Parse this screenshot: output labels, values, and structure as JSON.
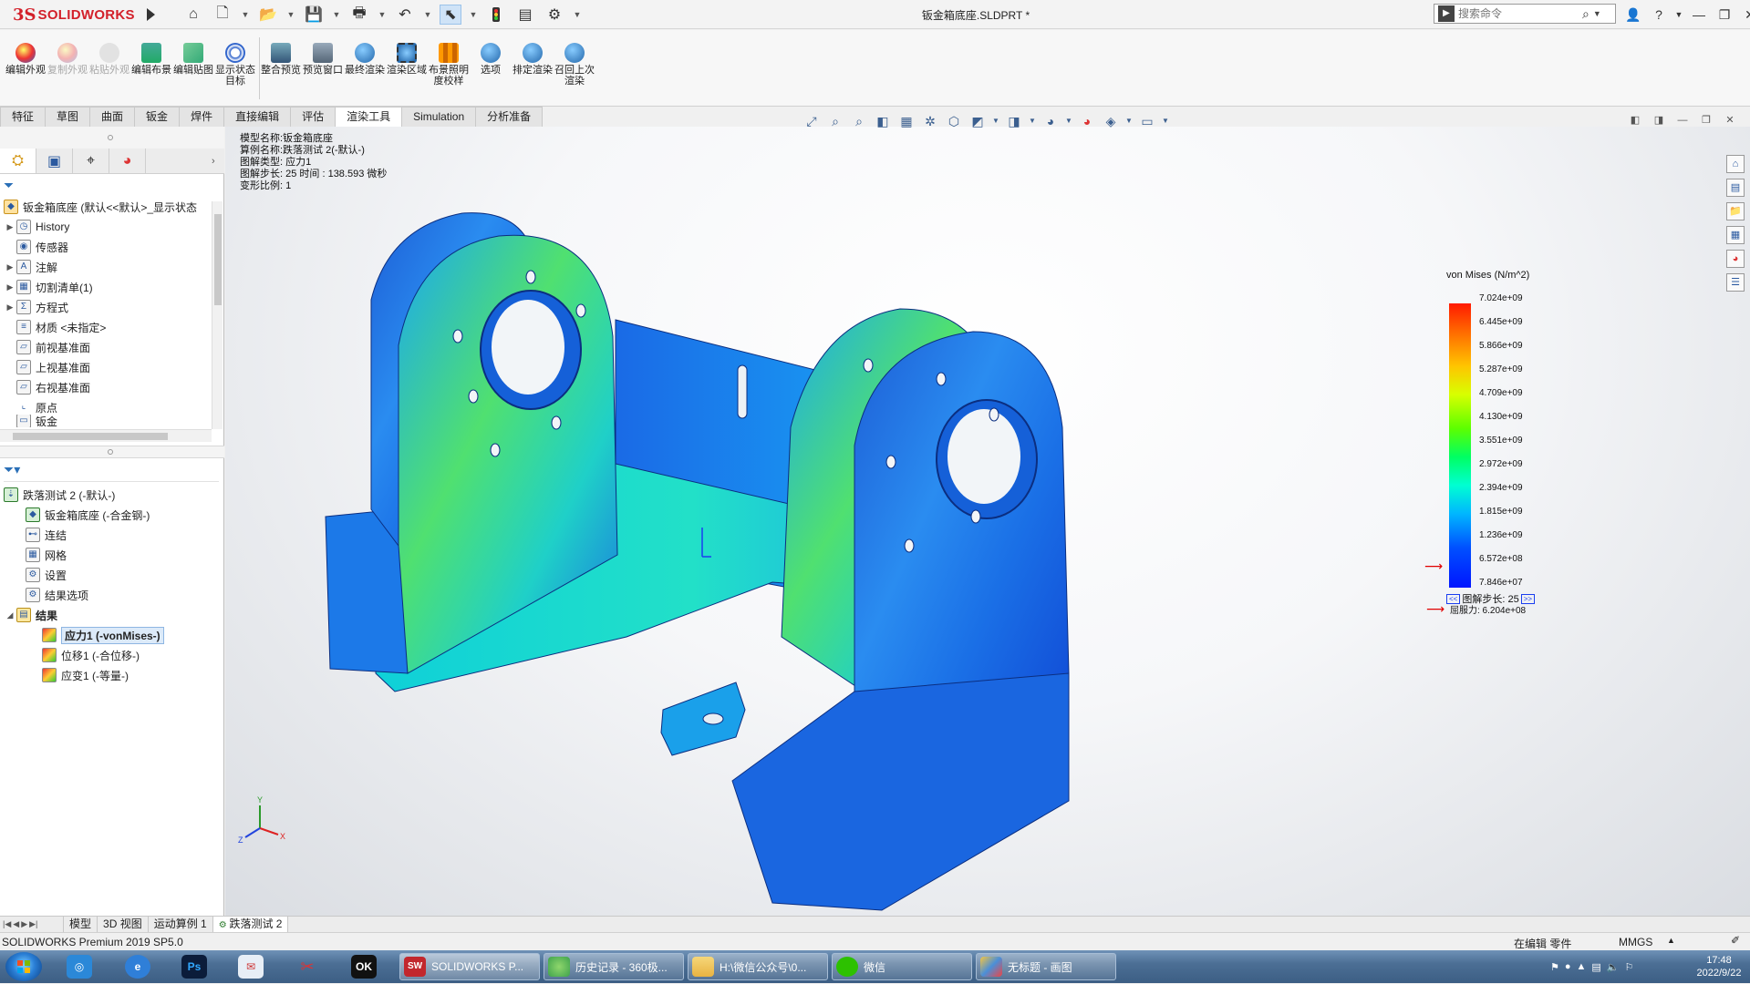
{
  "app": {
    "logo_text": "SOLIDWORKS",
    "window_title": "钣金箱底座.SLDPRT *",
    "search_placeholder": "搜索命令"
  },
  "commands": [
    {
      "label": "编辑外观",
      "enabled": true
    },
    {
      "label": "复制外观",
      "enabled": false
    },
    {
      "label": "粘贴外观",
      "enabled": false
    },
    {
      "label": "编辑布景",
      "enabled": true
    },
    {
      "label": "编辑贴图",
      "enabled": true
    },
    {
      "label": "显示状态目标",
      "enabled": true
    },
    {
      "label": "整合预览",
      "enabled": true
    },
    {
      "label": "预览窗口",
      "enabled": true
    },
    {
      "label": "最终渲染",
      "enabled": true
    },
    {
      "label": "渲染区域",
      "enabled": true
    },
    {
      "label": "布景照明度校样",
      "enabled": true
    },
    {
      "label": "选项",
      "enabled": true
    },
    {
      "label": "排定渲染",
      "enabled": true
    },
    {
      "label": "召回上次渲染",
      "enabled": true
    }
  ],
  "tabs": [
    "特征",
    "草图",
    "曲面",
    "钣金",
    "焊件",
    "直接编辑",
    "评估",
    "渲染工具",
    "Simulation",
    "分析准备"
  ],
  "active_tab": "渲染工具",
  "feature_tree": {
    "root": "钣金箱底座 (默认<<默认>_显示状态",
    "items": [
      {
        "label": "History",
        "expandable": true
      },
      {
        "label": "传感器",
        "expandable": false
      },
      {
        "label": "注解",
        "expandable": true
      },
      {
        "label": "切割清单(1)",
        "expandable": true
      },
      {
        "label": "方程式",
        "expandable": true
      },
      {
        "label": "材质 <未指定>",
        "expandable": false
      },
      {
        "label": "前视基准面",
        "expandable": false
      },
      {
        "label": "上视基准面",
        "expandable": false
      },
      {
        "label": "右视基准面",
        "expandable": false
      },
      {
        "label": "原点",
        "expandable": false
      },
      {
        "label": "钣金",
        "expandable": false
      }
    ]
  },
  "simulation_tree": {
    "root": "跌落测试 2 (-默认-)",
    "items": [
      {
        "label": "钣金箱底座 (-合金钢-)",
        "indent": 1
      },
      {
        "label": "连结",
        "indent": 1
      },
      {
        "label": "网格",
        "indent": 1
      },
      {
        "label": "设置",
        "indent": 1
      },
      {
        "label": "结果选项",
        "indent": 1
      },
      {
        "label": "结果",
        "indent": 0,
        "bold": true
      },
      {
        "label": "应力1 (-vonMises-)",
        "indent": 2,
        "selected": true
      },
      {
        "label": "位移1 (-合位移-)",
        "indent": 2
      },
      {
        "label": "应变1 (-等量-)",
        "indent": 2
      }
    ]
  },
  "plot_info": [
    "模型名称:钣金箱底座",
    "算例名称:跌落测试 2(-默认-)",
    "图解类型: 应力1",
    "图解步长: 25   时间 : 138.593 微秒",
    "变形比例: 1"
  ],
  "legend": {
    "title": "von Mises (N/m^2)",
    "values": [
      "7.024e+09",
      "6.445e+09",
      "5.866e+09",
      "5.287e+09",
      "4.709e+09",
      "4.130e+09",
      "3.551e+09",
      "2.972e+09",
      "2.394e+09",
      "1.815e+09",
      "1.236e+09",
      "6.572e+08",
      "7.846e+07"
    ],
    "nav_prev": "<<",
    "nav_next": ">>",
    "step_label": "图解步长: 25",
    "yield_label": "屈服力: 6.204e+08",
    "colors": {
      "max": "#ff1a00",
      "mid": "#00ff63",
      "min": "#0015ff"
    }
  },
  "bottom_tabs": [
    "模型",
    "3D 视图",
    "运动算例 1",
    "跌落测试 2"
  ],
  "status": {
    "left": "SOLIDWORKS Premium 2019 SP5.0",
    "editing": "在编辑 零件",
    "units": "MMGS"
  },
  "taskbar": {
    "tasks": [
      {
        "label": "SOLIDWORKS P...",
        "color": "#c2272d",
        "icon": "SW"
      },
      {
        "label": "历史记录 - 360极...",
        "color": "#3fa34d",
        "icon": ""
      },
      {
        "label": "H:\\微信公众号\\0...",
        "color": "#e8b341",
        "icon": ""
      },
      {
        "label": "微信",
        "color": "#2dc100",
        "icon": ""
      },
      {
        "label": "无标题 - 画图",
        "color": "#4a8fd8",
        "icon": ""
      }
    ],
    "time": "17:48",
    "date": "2022/9/22"
  }
}
